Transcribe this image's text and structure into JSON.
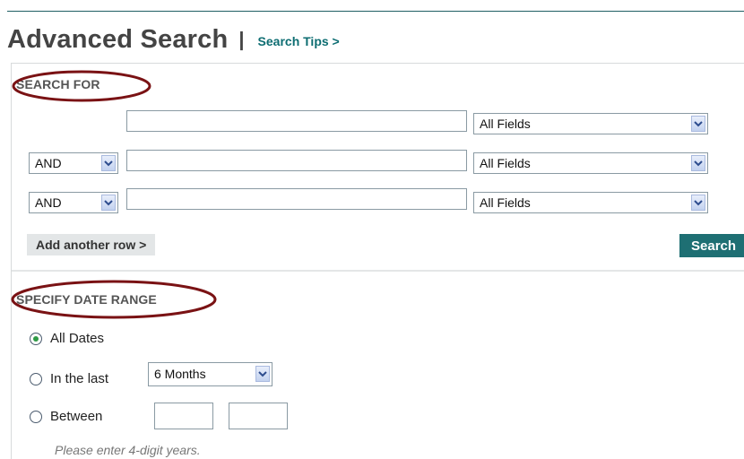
{
  "header": {
    "title": "Advanced Search",
    "separator": "|",
    "tips_link": "Search Tips >"
  },
  "search_for": {
    "section_label": "SEARCH FOR",
    "rows": [
      {
        "operator": "",
        "query": "",
        "field": "All Fields"
      },
      {
        "operator": "AND",
        "query": "",
        "field": "All Fields"
      },
      {
        "operator": "AND",
        "query": "",
        "field": "All Fields"
      }
    ],
    "add_row_label": "Add another row >",
    "search_button_label": "Search"
  },
  "date_range": {
    "section_label": "SPECIFY DATE RANGE",
    "options": {
      "all_dates": "All Dates",
      "in_the_last": "In the last",
      "between": "Between"
    },
    "selected": "all_dates",
    "in_the_last_value": "6 Months",
    "between_from": "",
    "between_to": "",
    "hint": "Please enter 4-digit years."
  },
  "colors": {
    "brand_teal": "#1e6f73",
    "link_teal": "#0d6d72",
    "annotation_oval": "#7a1214",
    "selected_radio": "#2e9a45"
  },
  "icons": {
    "dropdown": "chevron-down-icon",
    "radio_selected": "radio-selected-icon"
  }
}
